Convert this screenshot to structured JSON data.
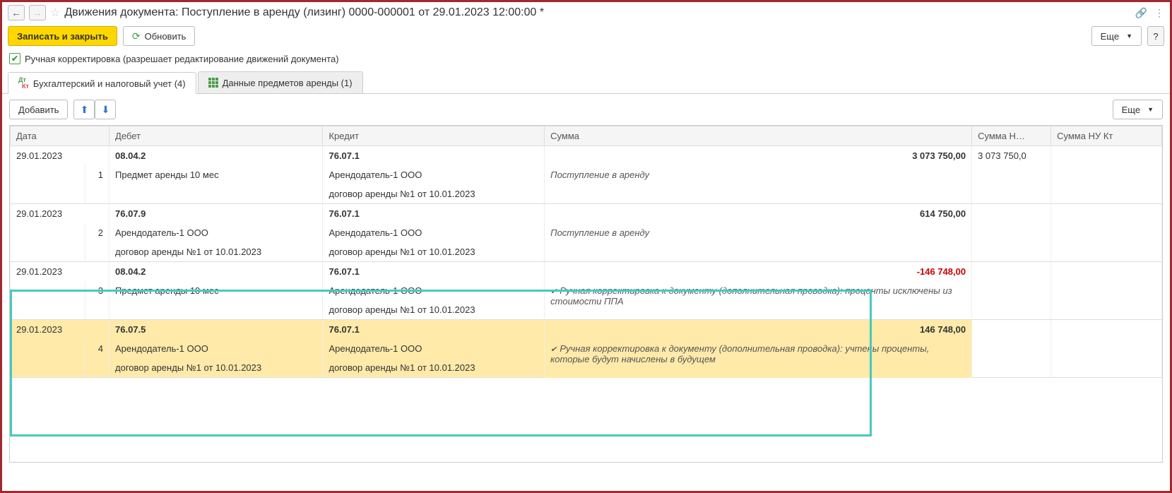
{
  "header": {
    "title": "Движения документа: Поступление в аренду (лизинг) 0000-000001 от 29.01.2023 12:00:00 *"
  },
  "toolbar": {
    "save_and_close": "Записать и закрыть",
    "refresh": "Обновить",
    "more": "Еще"
  },
  "checkbox": {
    "label": "Ручная корректировка (разрешает редактирование движений документа)"
  },
  "tabs": {
    "tab1": "Бухгалтерский и налоговый учет (4)",
    "tab2": "Данные предметов аренды (1)"
  },
  "sub_toolbar": {
    "add": "Добавить",
    "more": "Еще"
  },
  "columns": {
    "date": "Дата",
    "debit": "Дебет",
    "credit": "Кредит",
    "sum": "Сумма",
    "sum_nud": "Сумма Н…",
    "sum_nuk": "Сумма НУ Кт"
  },
  "rows": [
    {
      "date": "29.01.2023",
      "n": "1",
      "debit_acc": "08.04.2",
      "debit_sub1": "Предмет аренды 10 мес",
      "credit_acc": "76.07.1",
      "credit_sub1": "Арендодатель-1 ООО",
      "credit_sub2": "договор аренды №1 от 10.01.2023",
      "sum": "3 073 750,00",
      "sum_nud": "3 073 750,0",
      "desc": "Поступление в аренду"
    },
    {
      "date": "29.01.2023",
      "n": "2",
      "debit_acc": "76.07.9",
      "debit_sub1": "Арендодатель-1 ООО",
      "debit_sub2": "договор аренды №1 от 10.01.2023",
      "credit_acc": "76.07.1",
      "credit_sub1": "Арендодатель-1 ООО",
      "credit_sub2": "договор аренды №1 от 10.01.2023",
      "sum": "614 750,00",
      "desc": "Поступление в аренду"
    },
    {
      "date": "29.01.2023",
      "n": "3",
      "debit_acc": "08.04.2",
      "debit_sub1": "Предмет аренды 10 мес",
      "credit_acc": "76.07.1",
      "credit_sub1": "Арендодатель-1 ООО",
      "credit_sub2": "договор аренды №1 от 10.01.2023",
      "sum": "-146 748,00",
      "desc": "Ручная корректировка к документу (дополнительная проводка): проценты исключены из стоимости ППА"
    },
    {
      "date": "29.01.2023",
      "n": "4",
      "debit_acc": "76.07.5",
      "debit_sub1": "Арендодатель-1 ООО",
      "debit_sub2": "договор аренды №1 от 10.01.2023",
      "credit_acc": "76.07.1",
      "credit_sub1": "Арендодатель-1 ООО",
      "credit_sub2": "договор аренды №1 от 10.01.2023",
      "sum": "146 748,00",
      "desc": "Ручная корректировка к документу (дополнительная проводка): учтены проценты, которые будут начислены в будущем"
    }
  ]
}
